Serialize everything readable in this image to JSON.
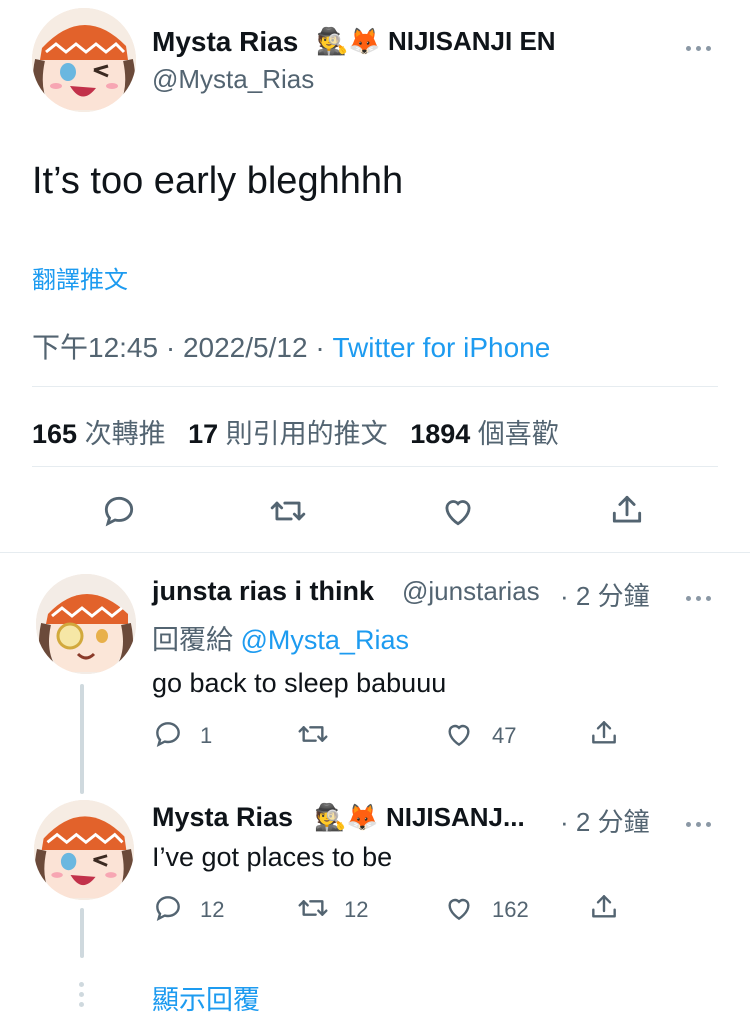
{
  "main_tweet": {
    "author": {
      "display_name": "Mysta Rias",
      "name_suffix": "🕵️🦊 NIJISANJI EN",
      "handle": "@Mysta_Rias"
    },
    "text": "It’s too early bleghhhh",
    "translate_label": "翻譯推文",
    "meta": {
      "time": "下午12:45",
      "date": "2022/5/12",
      "source": "Twitter for iPhone",
      "separator": "·"
    },
    "stats": {
      "retweets": "165",
      "retweets_label": "次轉推",
      "quotes": "17",
      "quotes_label": "則引用的推文",
      "likes": "1894",
      "likes_label": "個喜歡"
    }
  },
  "replies": [
    {
      "display_name": "junsta rias i think",
      "handle": "@junstarias",
      "time": "· 2 分鐘",
      "replying_label": "回覆給",
      "replying_to": "@Mysta_Rias",
      "text": "go back to sleep babuuu",
      "reply_count": "1",
      "retweet_count": "",
      "like_count": "47"
    },
    {
      "display_name": "Mysta Rias",
      "name_suffix": "🕵️🦊 NIJISANJ...",
      "time": "· 2 分鐘",
      "text": "I’ve got places to be",
      "reply_count": "12",
      "retweet_count": "12",
      "like_count": "162"
    }
  ],
  "show_replies_label": "顯示回覆",
  "colors": {
    "link": "#1d9bf0",
    "text": "#0f1419",
    "muted": "#536471",
    "divider": "#e6ecf0"
  },
  "icons": [
    "more-icon",
    "reply-icon",
    "retweet-icon",
    "like-icon",
    "share-icon"
  ]
}
